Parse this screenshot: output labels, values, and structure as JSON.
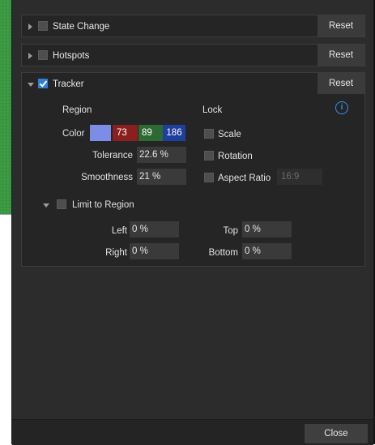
{
  "sections": {
    "state_change": {
      "title": "State Change",
      "reset": "Reset"
    },
    "hotspots": {
      "title": "Hotspots",
      "reset": "Reset"
    },
    "tracker": {
      "title": "Tracker",
      "reset": "Reset"
    }
  },
  "tracker": {
    "region_label": "Region",
    "lock_label": "Lock",
    "color_label": "Color",
    "color": {
      "swatch": "#7b8de6",
      "r": "73",
      "g": "89",
      "b": "186"
    },
    "tolerance_label": "Tolerance",
    "tolerance_value": "22.6 %",
    "smoothness_label": "Smoothness",
    "smoothness_value": "21 %",
    "lock": {
      "scale": "Scale",
      "rotation": "Rotation",
      "aspect_ratio": "Aspect Ratio",
      "aspect_value": "16:9"
    },
    "limit": {
      "label": "Limit to Region",
      "left_label": "Left",
      "left_value": "0 %",
      "top_label": "Top",
      "top_value": "0 %",
      "right_label": "Right",
      "right_value": "0 %",
      "bottom_label": "Bottom",
      "bottom_value": "0 %"
    }
  },
  "footer": {
    "close": "Close"
  },
  "icons": {
    "info": "info-icon",
    "expand": "chevron-right-icon",
    "collapse": "chevron-down-icon"
  },
  "colors": {
    "accent": "#2f7fd6",
    "red": "#8b1f1f",
    "green": "#2d6a33",
    "blue": "#1e3f9c"
  }
}
